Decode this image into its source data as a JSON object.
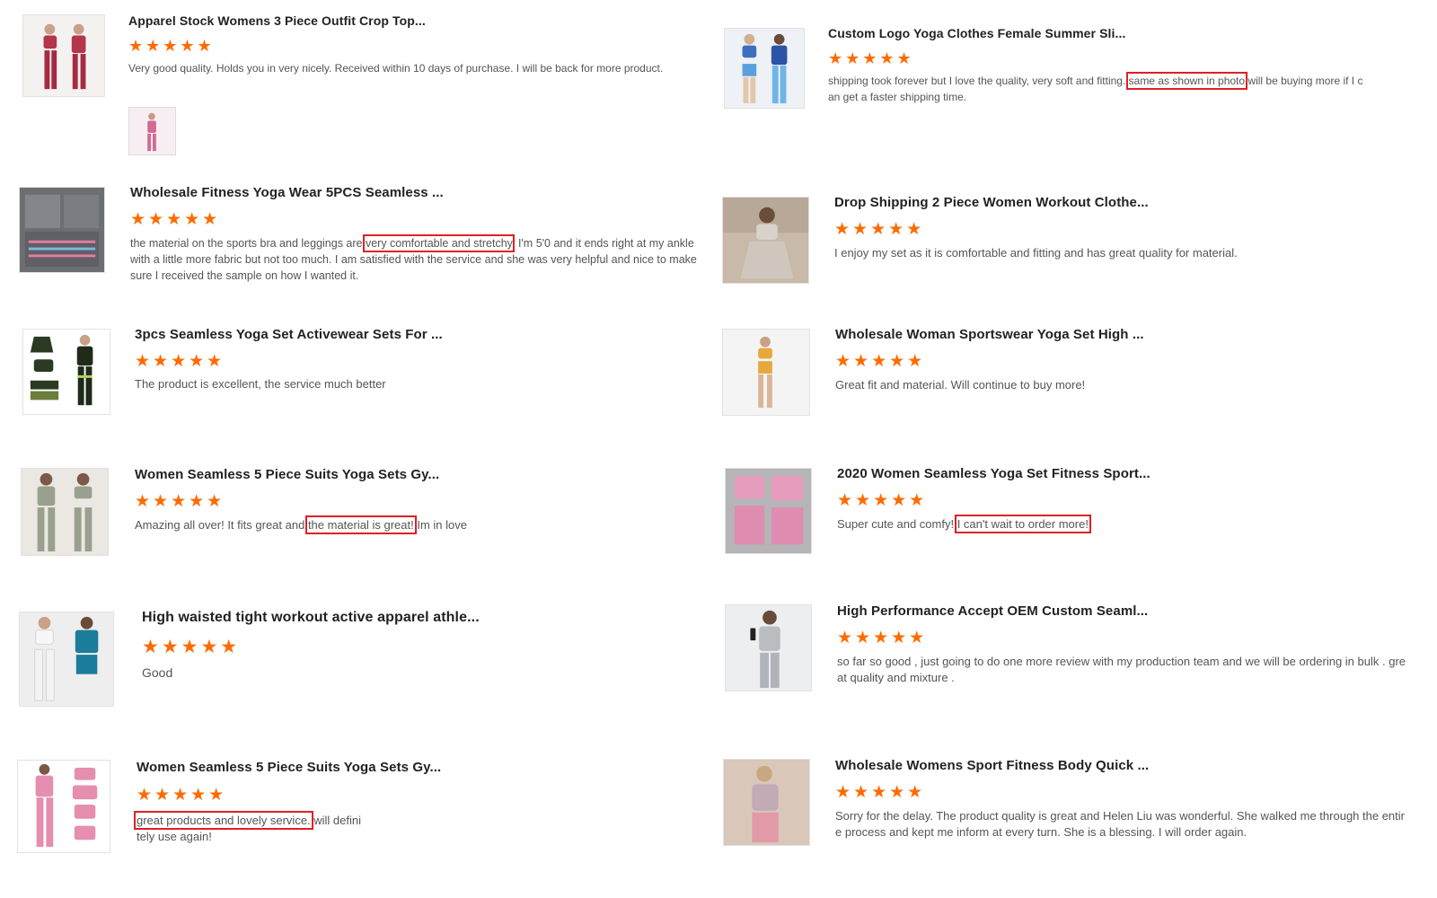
{
  "colors": {
    "star": "#ff6a00",
    "highlight_border": "#e01f26",
    "text": "#555555",
    "title": "#222222"
  },
  "star_glyph": "★★★★★",
  "reviews": [
    {
      "title": "Apparel Stock Womens 3 Piece Outfit Crop Top...",
      "rating": 5,
      "text_before": "Very good quality. Holds you in very nicely. Received within 10 days of purchase. I will be back for more product.",
      "highlight": "",
      "text_after": "",
      "has_attachment": true,
      "image_icon": "product-photo-icon"
    },
    {
      "title": "Custom Logo Yoga Clothes Female Summer Sli...",
      "rating": 5,
      "text_before": "shipping took forever but I love the quality, very soft and fitting. ",
      "highlight": "same as shown in photo",
      "text_after": " will be buying more if I can get a faster shipping time.",
      "has_attachment": false,
      "image_icon": "product-photo-icon"
    },
    {
      "title": "Wholesale Fitness Yoga Wear 5PCS Seamless ...",
      "rating": 5,
      "text_before": "the material on the sports bra and leggings are ",
      "highlight": "very comfortable and stretchy",
      "text_after": ". I'm 5'0 and it ends right at my ankle with a little more fabric but not too much. I am satisfied with the service and she was very helpful and nice to make sure I received the sample on how I wanted it.",
      "has_attachment": false,
      "image_icon": "product-photo-icon"
    },
    {
      "title": "Drop Shipping 2 Piece Women Workout Clothe...",
      "rating": 5,
      "text_before": "I enjoy my set as it is comfortable and fitting and has great quality for material.",
      "highlight": "",
      "text_after": "",
      "has_attachment": false,
      "image_icon": "product-photo-icon"
    },
    {
      "title": "3pcs Seamless Yoga Set Activewear Sets For ...",
      "rating": 5,
      "text_before": "The product is excellent, the service much better",
      "highlight": "",
      "text_after": "",
      "has_attachment": false,
      "image_icon": "product-photo-icon"
    },
    {
      "title": "Wholesale Woman Sportswear Yoga Set High ...",
      "rating": 5,
      "text_before": "Great fit and material. Will continue to buy more!",
      "highlight": "",
      "text_after": "",
      "has_attachment": false,
      "image_icon": "product-photo-icon"
    },
    {
      "title": "Women Seamless 5 Piece Suits Yoga Sets Gy...",
      "rating": 5,
      "text_before": "Amazing all over! It fits great and ",
      "highlight": "the material is great!",
      "text_after": " Im in love",
      "has_attachment": false,
      "image_icon": "product-photo-icon"
    },
    {
      "title": "2020 Women Seamless Yoga Set Fitness Sport...",
      "rating": 5,
      "text_before": "Super cute and comfy! ",
      "highlight": "I can't wait to order more!",
      "text_after": "",
      "has_attachment": false,
      "image_icon": "product-photo-icon"
    },
    {
      "title": "High waisted tight workout active apparel athle...",
      "rating": 5,
      "text_before": "Good",
      "highlight": "",
      "text_after": "",
      "has_attachment": false,
      "image_icon": "product-photo-icon"
    },
    {
      "title": "High Performance Accept OEM Custom Seaml...",
      "rating": 5,
      "text_before": "so far so good , just going to do one more review with my production team and we will be ordering in bulk . great quality and mixture .",
      "highlight": "",
      "text_after": "",
      "has_attachment": false,
      "image_icon": "product-photo-icon"
    },
    {
      "title": "Women Seamless 5 Piece Suits Yoga Sets Gy...",
      "rating": 5,
      "text_before": "",
      "highlight": "great products and lovely service.",
      "text_after": " will definitely use again!",
      "has_attachment": false,
      "image_icon": "product-photo-icon"
    },
    {
      "title": "Wholesale Womens Sport Fitness Body Quick ...",
      "rating": 5,
      "text_before": "Sorry for the delay. The product quality is great and Helen Liu was wonderful. She walked me through the entire process and kept me inform at every turn. She is a blessing. I will order again.",
      "highlight": "",
      "text_after": "",
      "has_attachment": false,
      "image_icon": "product-photo-icon"
    }
  ]
}
